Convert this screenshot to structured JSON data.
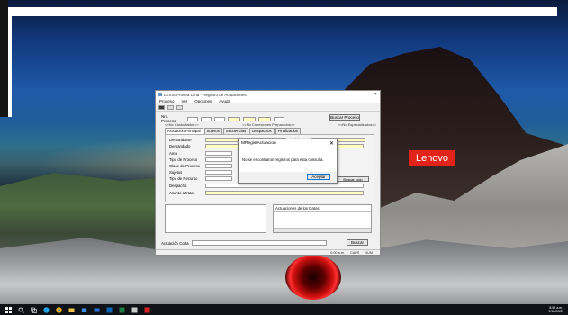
{
  "app_window": {
    "title": "LEXIS Provea Lima - Registro de Actuaciones",
    "menu": [
      "Proceso",
      "Ver",
      "Opciones",
      "Ayuda"
    ],
    "nro_proceso_label": "Nro. Proceso",
    "buscar_proceso_label": "Buscar Proceso",
    "sublinks": [
      "<<No Custodiados>>",
      "<<No Conexiones Preparados>>",
      "<<No Especializados>>"
    ],
    "tabs": [
      "Actuación Principal",
      "Sujetos",
      "Secuencias",
      "Despachos",
      "Finalizacion"
    ],
    "fields": {
      "demandante": "Demandante",
      "demandado": "Demandado",
      "area": "Area",
      "tipo_proceso": "Tipo de Proceso",
      "clase_proceso": "Clase de Proceso",
      "sujetos": "Sujetos",
      "tipo_recurso": "Tipo de Recurso",
      "despacho": "Despacho",
      "asunto": "Asunto a tratar",
      "cod_ex": "Cód. Ex."
    },
    "buscar_todo_label": "Buscar todo",
    "actuaciones_header": "Actuaciones de los Datos",
    "actuacion_corta_label": "Actuación Corta",
    "buscar_bottom_label": "Buscar",
    "status": [
      "0:00 a.m.",
      "CAPS",
      "NUM"
    ]
  },
  "dialog": {
    "title": "MRegistActuacion",
    "message": "No se encontraron registros para esta consulta.",
    "ok_label": "Aceptar"
  },
  "desktop": {
    "brand_label": "Lenovo",
    "brand_color": "#e2231a"
  },
  "taskbar": {
    "icons": [
      "windows-start-icon",
      "search-icon",
      "task-view-icon",
      "edge-icon",
      "chrome-icon",
      "file-explorer-icon",
      "store-icon",
      "mail-icon",
      "outlook-icon",
      "excel-icon",
      "app-icon",
      "acrobat-icon"
    ],
    "time": "8:59 a.m.",
    "date": "9/12/2022"
  }
}
